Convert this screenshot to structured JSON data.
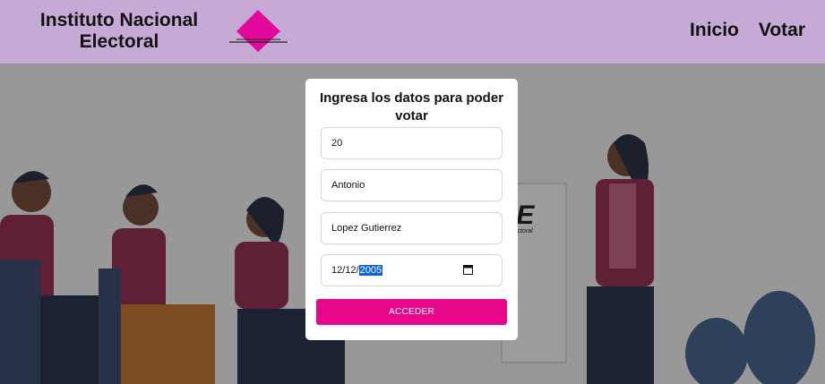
{
  "header": {
    "brand_line1": "Instituto Nacional",
    "brand_line2": "Electoral",
    "nav": [
      "Inicio",
      "Votar"
    ]
  },
  "colors": {
    "header_bg": "#c7a9d6",
    "accent": "#e6078a",
    "logo": "#e1089a"
  },
  "form": {
    "title": "Ingresa los datos para poder votar",
    "fields": {
      "field1": "20",
      "nombre": "Antonio",
      "apellidos": "Lopez Gutierrez",
      "fecha_day": "12",
      "fecha_month": "12",
      "fecha_year": "2005"
    },
    "submit_label": "ACCEDER"
  },
  "scene": {
    "sign_text_big": "IE",
    "sign_text_small": "lectoral"
  }
}
